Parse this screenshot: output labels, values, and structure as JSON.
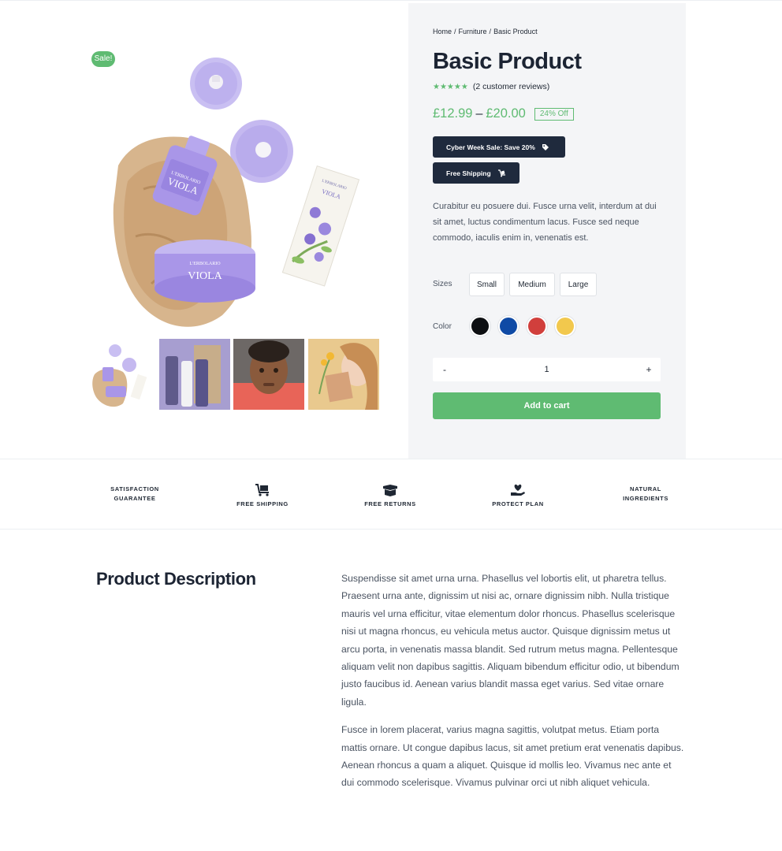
{
  "gallery": {
    "sale_badge": "Sale!"
  },
  "product": {
    "breadcrumb": [
      "Home",
      "Furniture",
      "Basic Product"
    ],
    "title": "Basic Product",
    "rating": 5,
    "reviews_text": "(2 customer reviews)",
    "price_low": "£12.99",
    "price_high": "£20.00",
    "discount": "24% Off",
    "promos": {
      "sale": "Cyber Week Sale: Save 20%",
      "shipping": "Free Shipping"
    },
    "short_description": "Curabitur eu posuere dui. Fusce urna velit, interdum at dui sit amet, luctus condimentum lacus. Fusce sed neque commodo, iaculis enim in, venenatis est.",
    "sizes_label": "Sizes",
    "sizes": [
      "Small",
      "Medium",
      "Large"
    ],
    "color_label": "Color",
    "colors": [
      "#0d0f12",
      "#0f4aa5",
      "#d13f3c",
      "#f2c84d"
    ],
    "quantity": {
      "minus": "-",
      "value": "1",
      "plus": "+"
    },
    "add_to_cart": "Add to cart"
  },
  "features": [
    {
      "label": "SATISFACTION GUARANTEE",
      "icon": "satisfaction-icon"
    },
    {
      "label": "FREE SHIPPING",
      "icon": "truck-icon"
    },
    {
      "label": "FREE RETURNS",
      "icon": "box-icon"
    },
    {
      "label": "PROTECT PLAN",
      "icon": "hand-heart-icon"
    },
    {
      "label": "NATURAL INGREDIENTS",
      "icon": "leaf-icon"
    }
  ],
  "description": {
    "heading": "Product Description",
    "paragraphs": [
      "Suspendisse sit amet urna urna. Phasellus vel lobortis elit, ut pharetra tellus. Praesent urna ante, dignissim ut nisi ac, ornare dignissim nibh. Nulla tristique mauris vel urna efficitur, vitae elementum dolor rhoncus. Phasellus scelerisque nisi ut magna rhoncus, eu vehicula metus auctor. Quisque dignissim metus ut arcu porta, in venenatis massa blandit. Sed rutrum metus magna. Pellentesque aliquam velit non dapibus sagittis. Aliquam bibendum efficitur odio, ut bibendum justo faucibus id. Aenean varius blandit massa eget varius. Sed vitae ornare ligula.",
      "Fusce in lorem placerat, varius magna sagittis, volutpat metus. Etiam porta mattis ornare. Ut congue dapibus lacus, sit amet pretium erat venenatis dapibus. Aenean rhoncus a quam a aliquet. Quisque id mollis leo. Vivamus nec ante et dui commodo scelerisque. Vivamus pulvinar orci ut nibh aliquet vehicula."
    ]
  }
}
